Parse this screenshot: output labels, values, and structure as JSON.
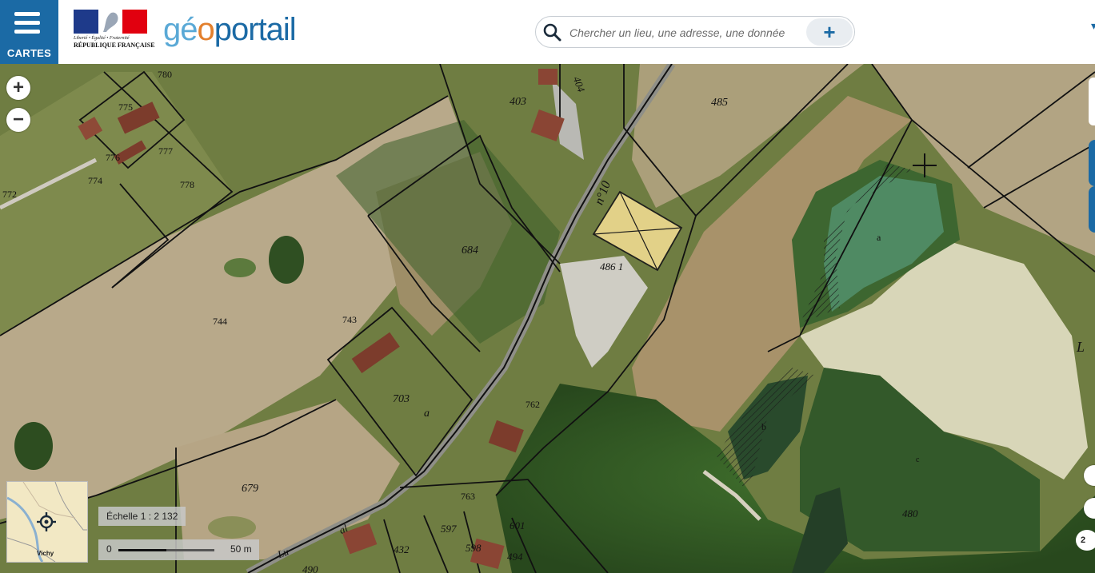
{
  "header": {
    "menu_label": "CARTES",
    "rf_motto": "Liberté • Égalité • Fraternité",
    "rf_name": "RÉPUBLIQUE FRANÇAISE",
    "brand_part1": "gé",
    "brand_part2": "o",
    "brand_part3": "portail",
    "search_placeholder": "Chercher un lieu, une adresse, une donnée",
    "search_add_label": "+",
    "dropdown_caret": "▾"
  },
  "controls": {
    "zoom_in": "+",
    "zoom_out": "−"
  },
  "minimap": {
    "city": "Vichy"
  },
  "scale": {
    "ratio_text": "Échelle 1 : 2 132",
    "zero": "0",
    "max": "50 m"
  },
  "side": {
    "counter": "2"
  },
  "parcels": [
    {
      "id": "p780",
      "label": "780"
    },
    {
      "id": "p775",
      "label": "775"
    },
    {
      "id": "p777",
      "label": "777"
    },
    {
      "id": "p776",
      "label": "776"
    },
    {
      "id": "p774",
      "label": "774"
    },
    {
      "id": "p778",
      "label": "778"
    },
    {
      "id": "p772",
      "label": "772"
    },
    {
      "id": "p403",
      "label": "403"
    },
    {
      "id": "p404",
      "label": "404"
    },
    {
      "id": "p485",
      "label": "485"
    },
    {
      "id": "pn10",
      "label": "n°10"
    },
    {
      "id": "p684",
      "label": "684"
    },
    {
      "id": "p486",
      "label": "486 1"
    },
    {
      "id": "pa",
      "label": "a"
    },
    {
      "id": "pL",
      "label": "L"
    },
    {
      "id": "p744",
      "label": "744"
    },
    {
      "id": "p743",
      "label": "743"
    },
    {
      "id": "p703",
      "label": "703"
    },
    {
      "id": "p703a",
      "label": "a"
    },
    {
      "id": "p762",
      "label": "762"
    },
    {
      "id": "pb",
      "label": "b"
    },
    {
      "id": "pc",
      "label": "c"
    },
    {
      "id": "p679",
      "label": "679"
    },
    {
      "id": "p763",
      "label": "763"
    },
    {
      "id": "p480",
      "label": "480"
    },
    {
      "id": "p597",
      "label": "597"
    },
    {
      "id": "p601",
      "label": "601"
    },
    {
      "id": "p598",
      "label": "598"
    },
    {
      "id": "p494",
      "label": "494"
    },
    {
      "id": "p432",
      "label": "432"
    },
    {
      "id": "p490",
      "label": "490"
    },
    {
      "id": "pal",
      "label": "al"
    },
    {
      "id": "pLu",
      "label": "Lu"
    }
  ],
  "colors": {
    "brand_blue": "#1b6aa5",
    "brand_light": "#5aa9d6",
    "brand_orange": "#e3802d"
  }
}
